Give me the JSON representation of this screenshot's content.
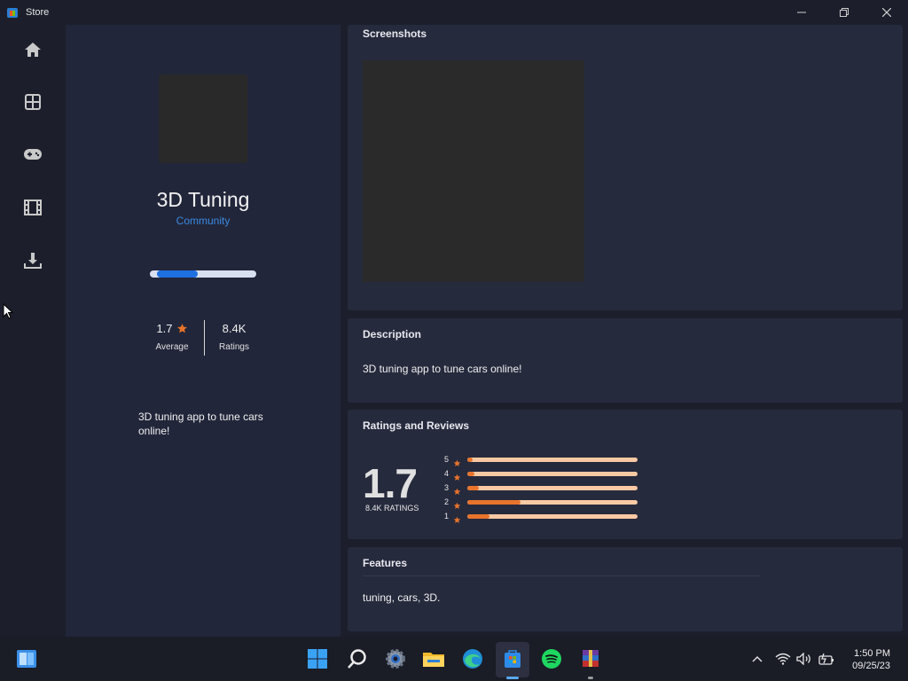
{
  "window": {
    "title": "Store",
    "icons": {
      "app": "store-icon",
      "minimize": "minimize-icon",
      "maximize": "restore-icon",
      "close": "close-icon"
    }
  },
  "nav": {
    "items": [
      {
        "name": "home",
        "icon": "home-icon"
      },
      {
        "name": "apps",
        "icon": "apps-grid-icon"
      },
      {
        "name": "gaming",
        "icon": "gamepad-icon"
      },
      {
        "name": "movies",
        "icon": "film-icon"
      },
      {
        "name": "downloads",
        "icon": "download-icon"
      }
    ]
  },
  "app": {
    "title": "3D Tuning",
    "publisher": "Community",
    "progress": 0.45,
    "rating_value": "1.7",
    "rating_label": "Average",
    "ratings_count": "8.4K",
    "ratings_label": "Ratings",
    "short_description": "3D tuning app to tune cars online!"
  },
  "sections": {
    "screenshots": {
      "title": "Screenshots"
    },
    "description": {
      "title": "Description",
      "text": "3D tuning app to tune cars online!"
    },
    "ratings": {
      "title": "Ratings and Reviews",
      "big_value": "1.7",
      "count_label": "8.4K RATINGS",
      "bars": [
        {
          "stars": "5",
          "fraction": 0.03
        },
        {
          "stars": "4",
          "fraction": 0.04
        },
        {
          "stars": "3",
          "fraction": 0.07
        },
        {
          "stars": "2",
          "fraction": 0.31
        },
        {
          "stars": "1",
          "fraction": 0.13
        }
      ]
    },
    "features": {
      "title": "Features",
      "text": "tuning, cars, 3D."
    }
  },
  "taskbar": {
    "items": [
      "widgets-icon",
      "start-icon",
      "search-icon",
      "settings-icon",
      "file-explorer-icon",
      "edge-icon",
      "store-icon",
      "spotify-icon",
      "winrar-icon"
    ],
    "tray": [
      "chevron-up-icon",
      "wifi-icon",
      "volume-icon",
      "battery-icon"
    ],
    "time": "1:50 PM",
    "date": "09/25/23"
  },
  "colors": {
    "accent": "#1e6fe0",
    "star": "#e8742b",
    "bar_track": "#f8c9a3",
    "publisher": "#3a8ae0"
  }
}
